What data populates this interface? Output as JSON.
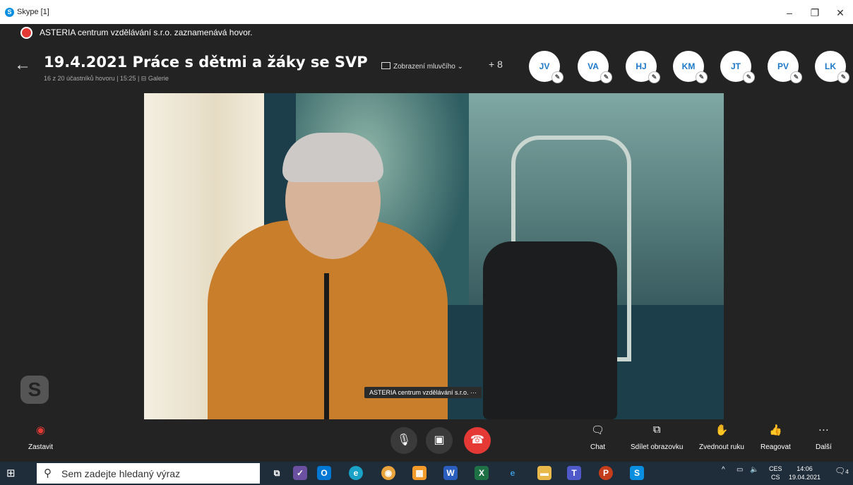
{
  "window": {
    "title": "Skype [1]"
  },
  "recording": {
    "text": "ASTERIA centrum vzdělávání s.r.o. zaznamenává hovor."
  },
  "meeting": {
    "title": "19.4.2021 Práce s dětmi a žáky se SVP",
    "participants": "16 z 20 účastníků hovoru",
    "time": "15:25",
    "gallery": "Galerie",
    "view_mode": "Zobrazení mluvčího",
    "extra_participants": "+ 8"
  },
  "avatars": [
    "JV",
    "VA",
    "HJ",
    "KM",
    "JT",
    "PV",
    "LK"
  ],
  "video": {
    "name_tag": "ASTERIA centrum vzdělávání s.r.o.",
    "name_tag_more": "···"
  },
  "controls": {
    "stop": "Zastavit",
    "chat": "Chat",
    "share": "Sdílet obrazovku",
    "raise": "Zvednout ruku",
    "react": "Reagovat",
    "more": "Další"
  },
  "taskbar": {
    "search_placeholder": "Sem zadejte hledaný výraz",
    "lang1": "CES",
    "lang2": "CS",
    "time": "14:06",
    "date": "19.04.2021",
    "notifications": "4"
  },
  "colors": {
    "accent": "#1e78c8",
    "hangup": "#e53935",
    "background": "#232323"
  }
}
